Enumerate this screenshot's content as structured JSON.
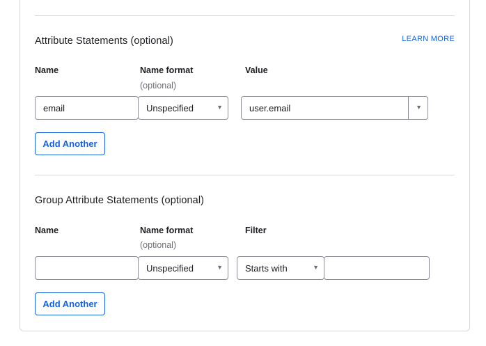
{
  "attribute_statements": {
    "title": "Attribute Statements (optional)",
    "learn_more": "LEARN MORE",
    "columns": {
      "name": "Name",
      "name_format": "Name format",
      "name_format_hint": "(optional)",
      "value": "Value"
    },
    "row": {
      "name_value": "email",
      "name_format_value": "Unspecified",
      "value_value": "user.email"
    },
    "add_button": "Add Another"
  },
  "group_attribute_statements": {
    "title": "Group Attribute Statements (optional)",
    "columns": {
      "name": "Name",
      "name_format": "Name format",
      "name_format_hint": "(optional)",
      "filter": "Filter"
    },
    "row": {
      "name_value": "",
      "name_format_value": "Unspecified",
      "filter_type_value": "Starts with",
      "filter_value": ""
    },
    "add_button": "Add Another"
  },
  "icons": {
    "dropdown": "caret-down-icon"
  },
  "colors": {
    "accent": "#1662dd",
    "border": "#8c8c96",
    "divider": "#dcdce0"
  }
}
